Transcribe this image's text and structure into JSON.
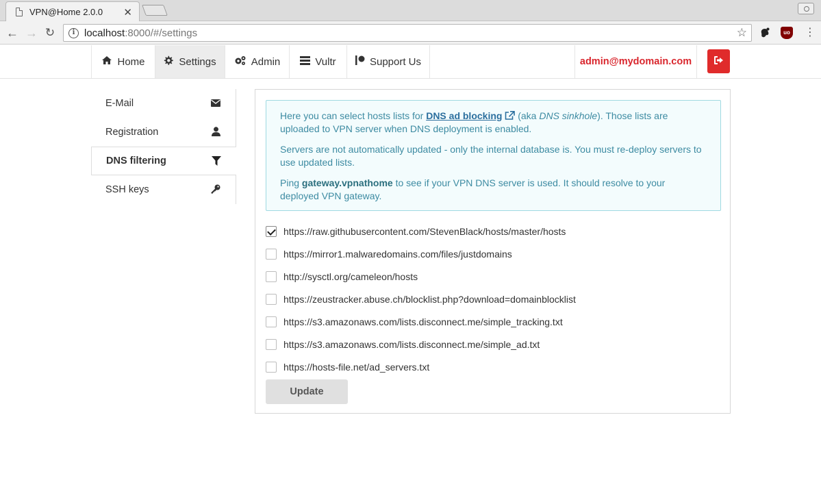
{
  "browser": {
    "tab_title": "VPN@Home 2.0.0",
    "tab_close": "✕",
    "url_host": "localhost",
    "url_path": ":8000/#/settings"
  },
  "navbar": {
    "items": [
      {
        "label": "Home",
        "icon": "home-icon"
      },
      {
        "label": "Settings",
        "icon": "gear-icon"
      },
      {
        "label": "Admin",
        "icon": "gears-icon"
      },
      {
        "label": "Vultr",
        "icon": "server-icon"
      },
      {
        "label": "Support Us",
        "icon": "patreon-icon"
      }
    ],
    "user_email": "admin@mydomain.com"
  },
  "sidebar": {
    "items": [
      {
        "label": "E-Mail",
        "icon": "envelope-icon"
      },
      {
        "label": "Registration",
        "icon": "user-icon"
      },
      {
        "label": "DNS filtering",
        "icon": "filter-icon"
      },
      {
        "label": "SSH keys",
        "icon": "key-icon"
      }
    ],
    "active": "DNS filtering"
  },
  "info": {
    "p1_before": "Here you can select hosts lists for ",
    "p1_link": "DNS ad blocking",
    "p1_mid": " (aka ",
    "p1_em": "DNS sinkhole",
    "p1_after": "). Those lists are uploaded to VPN server when DNS deployment is enabled.",
    "p2": "Servers are not automatically updated - only the internal database is. You must re-deploy servers to use updated lists.",
    "p3_before": "Ping ",
    "p3_strong": "gateway.vpnathome",
    "p3_after": " to see if your VPN DNS server is used. It should resolve to your deployed VPN gateway."
  },
  "hosts_lists": [
    {
      "url": "https://raw.githubusercontent.com/StevenBlack/hosts/master/hosts",
      "checked": true
    },
    {
      "url": "https://mirror1.malwaredomains.com/files/justdomains",
      "checked": false
    },
    {
      "url": "http://sysctl.org/cameleon/hosts",
      "checked": false
    },
    {
      "url": "https://zeustracker.abuse.ch/blocklist.php?download=domainblocklist",
      "checked": false
    },
    {
      "url": "https://s3.amazonaws.com/lists.disconnect.me/simple_tracking.txt",
      "checked": false
    },
    {
      "url": "https://s3.amazonaws.com/lists.disconnect.me/simple_ad.txt",
      "checked": false
    },
    {
      "url": "https://hosts-file.net/ad_servers.txt",
      "checked": false
    }
  ],
  "update_label": "Update",
  "colors": {
    "accent_red": "#e02b2b",
    "info_text": "#3d8ba2",
    "info_bg": "#f3fcfd"
  }
}
